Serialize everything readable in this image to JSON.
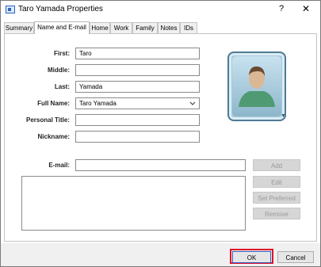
{
  "window": {
    "title": "Taro Yamada Properties",
    "help_label": "?",
    "close_label": "✕"
  },
  "tabs": [
    {
      "label": "Summary",
      "active": false
    },
    {
      "label": "Name and E-mail",
      "active": true
    },
    {
      "label": "Home",
      "active": false
    },
    {
      "label": "Work",
      "active": false
    },
    {
      "label": "Family",
      "active": false
    },
    {
      "label": "Notes",
      "active": false
    },
    {
      "label": "IDs",
      "active": false
    }
  ],
  "form": {
    "first_label": "First:",
    "first_value": "Taro",
    "middle_label": "Middle:",
    "middle_value": "",
    "last_label": "Last:",
    "last_value": "Yamada",
    "fullname_label": "Full Name:",
    "fullname_value": "Taro Yamada",
    "personal_title_label": "Personal Title:",
    "personal_title_value": "",
    "nickname_label": "Nickname:",
    "nickname_value": "",
    "email_label": "E-mail:",
    "email_value": ""
  },
  "email_buttons": {
    "add": "Add",
    "edit": "Edit",
    "set_preferred": "Set Preferred",
    "remove": "Remove"
  },
  "footer": {
    "ok": "OK",
    "cancel": "Cancel"
  },
  "colors": {
    "highlight": "#e0102a",
    "photo_frame": "#4f7b95"
  },
  "icons": {
    "title": "contact-card-icon",
    "photo": "contact-photo-placeholder",
    "combo": "chevron-down-icon",
    "photo_menu": "triangle-down-icon"
  }
}
